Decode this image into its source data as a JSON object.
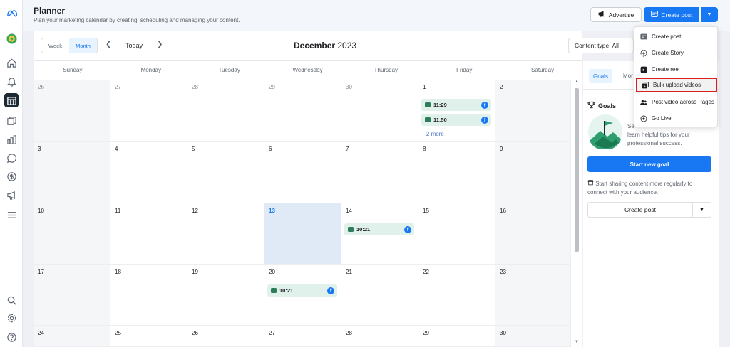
{
  "header": {
    "title": "Planner",
    "subtitle": "Plan your marketing calendar by creating, scheduling and managing your content.",
    "advertise_label": "Advertise",
    "create_post_label": "Create post"
  },
  "toolbar": {
    "week_label": "Week",
    "month_label": "Month",
    "today_label": "Today",
    "month_name": "December",
    "year": "2023",
    "content_type_label": "Content type: All"
  },
  "weekdays": [
    "Sunday",
    "Monday",
    "Tuesday",
    "Wednesday",
    "Thursday",
    "Friday",
    "Saturday"
  ],
  "calendar": {
    "days": [
      "26",
      "27",
      "28",
      "29",
      "30",
      "1",
      "2",
      "3",
      "4",
      "5",
      "6",
      "7",
      "8",
      "9",
      "10",
      "11",
      "12",
      "13",
      "14",
      "15",
      "16",
      "17",
      "18",
      "19",
      "20",
      "21",
      "22",
      "23",
      "24",
      "25",
      "26",
      "27",
      "28",
      "29",
      "30"
    ],
    "events": {
      "dec1_a": "11:29",
      "dec1_b": "11:50",
      "dec1_more": "+ 2 more",
      "dec14": "10:21",
      "dec20": "10:21"
    }
  },
  "dropdown": {
    "items": [
      "Create post",
      "Create Story",
      "Create reel",
      "Bulk upload videos",
      "Post video across Pages",
      "Go Live"
    ]
  },
  "right_panel": {
    "tab_goals": "Goals",
    "tab_more": "Mor",
    "goals_title": "Goals",
    "goals_text_line1": "Se",
    "goals_text_line2": "learn helpful tips for your",
    "goals_text_line3": "professional success.",
    "start_goal_label": "Start new goal",
    "share_text": "Start sharing content more regularly to connect with your audience.",
    "create_post_label": "Create post"
  },
  "colors": {
    "accent": "#1877f2",
    "event_bg": "#e0f1ec",
    "highlight": "#d8201f",
    "today_bg": "#dfeaf6"
  }
}
